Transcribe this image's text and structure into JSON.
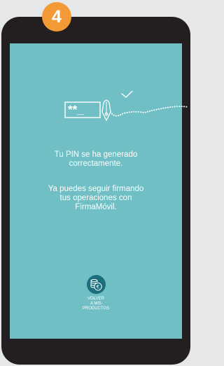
{
  "step": {
    "number": "4"
  },
  "illustration": {
    "pin_masked": "**_"
  },
  "message": {
    "line1": "Tu PIN se ha generado",
    "line2": "correctamente.",
    "line3": "Ya puedes seguir firmando",
    "line4": "tus operaciones con",
    "line5": "FirmaMóvil."
  },
  "action": {
    "icon": "coins-euro-icon",
    "label_line1": "VOLVER",
    "label_line2": "A MIS",
    "label_line3": "PRODUCTOS"
  },
  "colors": {
    "screen": "#6fbfc4",
    "badge": "#f39a37",
    "phone_body": "#231f20",
    "action_button": "#1a6f7c"
  }
}
